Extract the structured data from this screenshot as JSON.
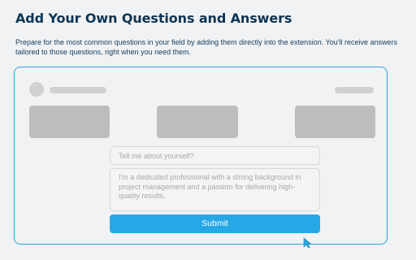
{
  "header": {
    "title": "Add Your Own Questions and Answers",
    "description": "Prepare for the most common questions in your field by adding them directly into the extension. You'll receive answers tailored to those questions, right when you need them."
  },
  "mockup": {
    "question_placeholder": "Tell me about yourself?",
    "answer_text": "I'm a dedicated professional with a strong background in project management and a passion for delivering high-quality results.",
    "submit_label": "Submit"
  },
  "colors": {
    "title": "#0d3554",
    "accent": "#27a8e6",
    "frame_border": "#27a6e2",
    "skeleton": "#bdbdbd",
    "background": "#f1f2f3"
  },
  "icons": {
    "cursor": "pointer-cursor-icon"
  }
}
